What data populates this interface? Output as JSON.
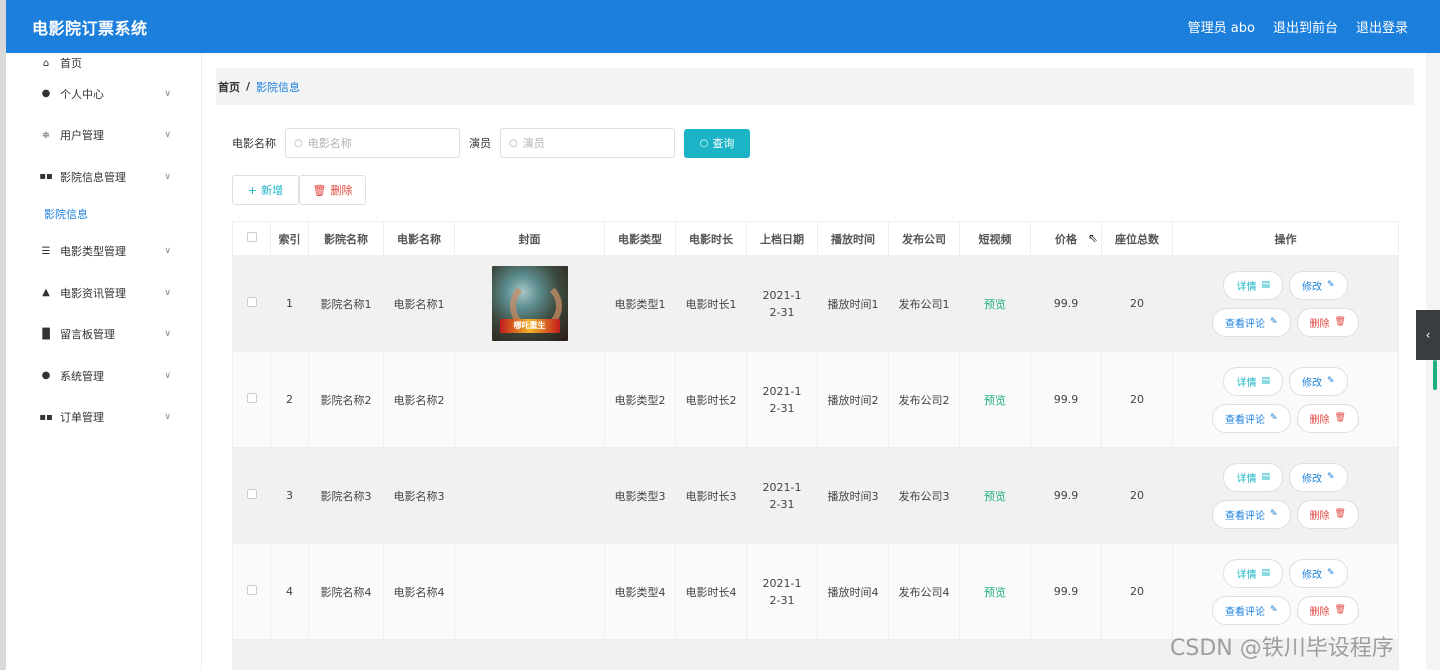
{
  "header": {
    "app_title": "电影院订票系统",
    "admin_label": "管理员 abo",
    "to_front": "退出到前台",
    "logout": "退出登录"
  },
  "sidebar": {
    "items": [
      {
        "label": "首页",
        "icon": "home-icon"
      },
      {
        "label": "个人中心",
        "icon": "user-icon"
      },
      {
        "label": "用户管理",
        "icon": "sliders-icon"
      },
      {
        "label": "影院信息管理",
        "icon": "grid-icon"
      },
      {
        "label": "影院信息",
        "icon": ""
      },
      {
        "label": "电影类型管理",
        "icon": "list-icon"
      },
      {
        "label": "电影资讯管理",
        "icon": "person-icon"
      },
      {
        "label": "留言板管理",
        "icon": "chart-icon"
      },
      {
        "label": "系统管理",
        "icon": "pin-icon"
      },
      {
        "label": "订单管理",
        "icon": "grid-icon"
      }
    ]
  },
  "breadcrumb": {
    "home": "首页",
    "sep": "/",
    "current": "影院信息"
  },
  "search": {
    "movie_label": "电影名称",
    "movie_placeholder": "电影名称",
    "actor_label": "演员",
    "actor_placeholder": "演员",
    "query_label": "查询"
  },
  "actions": {
    "add_label": "新增",
    "delete_label": "删除"
  },
  "table": {
    "headers": [
      "索引",
      "影院名称",
      "电影名称",
      "封面",
      "电影类型",
      "电影时长",
      "上档日期",
      "播放时间",
      "发布公司",
      "短视频",
      "价格",
      "座位总数",
      "操作"
    ],
    "rows": [
      {
        "index": "1",
        "cinema": "影院名称1",
        "movie": "电影名称1",
        "type": "电影类型1",
        "duration": "电影时长1",
        "date": "2021-12-31",
        "play_time": "播放时间1",
        "company": "发布公司1",
        "video": "预览",
        "price": "99.9",
        "seats": "20",
        "cover_text": "哪吒重生"
      },
      {
        "index": "2",
        "cinema": "影院名称2",
        "movie": "电影名称2",
        "type": "电影类型2",
        "duration": "电影时长2",
        "date": "2021-12-31",
        "play_time": "播放时间2",
        "company": "发布公司2",
        "video": "预览",
        "price": "99.9",
        "seats": "20"
      },
      {
        "index": "3",
        "cinema": "影院名称3",
        "movie": "电影名称3",
        "type": "电影类型3",
        "duration": "电影时长3",
        "date": "2021-12-31",
        "play_time": "播放时间3",
        "company": "发布公司3",
        "video": "预览",
        "price": "99.9",
        "seats": "20"
      },
      {
        "index": "4",
        "cinema": "影院名称4",
        "movie": "电影名称4",
        "type": "电影类型4",
        "duration": "电影时长4",
        "date": "2021-12-31",
        "play_time": "播放时间4",
        "company": "发布公司4",
        "video": "预览",
        "price": "99.9",
        "seats": "20"
      },
      {
        "index": "",
        "cinema": "",
        "movie": "",
        "type": "",
        "duration": "",
        "date": "",
        "play_time": "",
        "company": "",
        "video": "",
        "price": "",
        "seats": ""
      }
    ],
    "op_labels": {
      "detail": "详情",
      "edit": "修改",
      "review": "查看评论",
      "delete": "删除"
    }
  },
  "watermark": "CSDN @铁川毕设程序"
}
